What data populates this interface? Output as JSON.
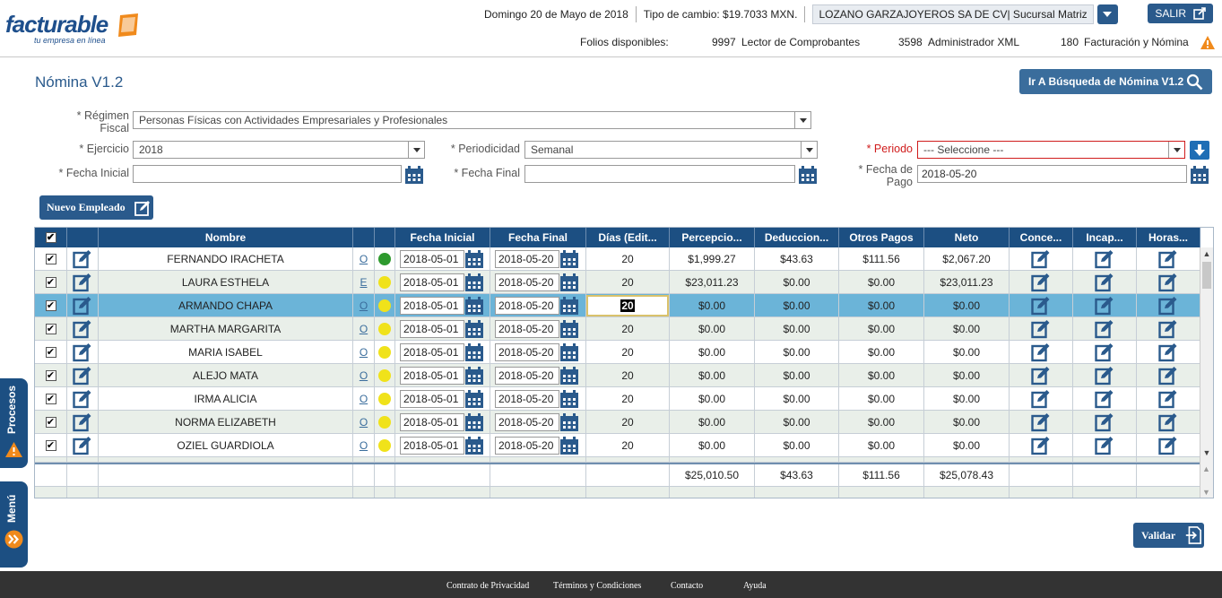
{
  "header": {
    "logo_brand": "facturable",
    "logo_tagline": "tu empresa en línea",
    "date": "Domingo 20 de Mayo de 2018",
    "exchange_rate": "Tipo de cambio: $19.7033 MXN.",
    "company": "LOZANO GARZAJOYEROS SA DE CV| Sucursal Matriz",
    "salir_label": "SALIR",
    "folios_label": "Folios disponibles:",
    "folios": [
      {
        "count": "9997",
        "label": "Lector de Comprobantes"
      },
      {
        "count": "3598",
        "label": "Administrador XML"
      },
      {
        "count": "180",
        "label": "Facturación y Nómina"
      }
    ]
  },
  "page": {
    "title": "Nómina V1.2",
    "search_button": "Ir A Búsqueda de  Nómina V1.2",
    "new_employee_button": "Nuevo Empleado",
    "validate_button": "Validar"
  },
  "form": {
    "regimen_label": "* Régimen Fiscal",
    "regimen_value": "Personas Físicas con Actividades Empresariales y Profesionales",
    "ejercicio_label": "* Ejercicio",
    "ejercicio_value": "2018",
    "periodicidad_label": "* Periodicidad",
    "periodicidad_value": "Semanal",
    "periodo_label": "* Periodo",
    "periodo_value": "--- Seleccione ---",
    "fecha_inicial_label": "* Fecha Inicial",
    "fecha_inicial_value": "",
    "fecha_final_label": "* Fecha Final",
    "fecha_final_value": "",
    "fecha_pago_label": "* Fecha de Pago",
    "fecha_pago_value": "2018-05-20"
  },
  "grid": {
    "headers": [
      "Nombre",
      "Fecha Inicial",
      "Fecha Final",
      "Días (Edit...",
      "Percepcio...",
      "Deduccion...",
      "Otros Pagos",
      "Neto",
      "Conce...",
      "Incap...",
      "Horas..."
    ],
    "rows": [
      {
        "name": "FERNANDO IRACHETA",
        "code": "O",
        "status_color": "#2e9a2e",
        "fi": "2018-05-01",
        "ff": "2018-05-20",
        "dias": "20",
        "perc": "$1,999.27",
        "ded": "$43.63",
        "otros": "$111.56",
        "neto": "$2,067.20"
      },
      {
        "name": "LAURA ESTHELA",
        "code": "E",
        "status_color": "#f0e21a",
        "fi": "2018-05-01",
        "ff": "2018-05-20",
        "dias": "20",
        "perc": "$23,011.23",
        "ded": "$0.00",
        "otros": "$0.00",
        "neto": "$23,011.23"
      },
      {
        "name": "ARMANDO CHAPA",
        "code": "O",
        "status_color": "#f0e21a",
        "fi": "2018-05-01",
        "ff": "2018-05-20",
        "dias": "20",
        "perc": "$0.00",
        "ded": "$0.00",
        "otros": "$0.00",
        "neto": "$0.00"
      },
      {
        "name": "MARTHA MARGARITA",
        "code": "O",
        "status_color": "#f0e21a",
        "fi": "2018-05-01",
        "ff": "2018-05-20",
        "dias": "20",
        "perc": "$0.00",
        "ded": "$0.00",
        "otros": "$0.00",
        "neto": "$0.00"
      },
      {
        "name": "MARIA ISABEL",
        "code": "O",
        "status_color": "#f0e21a",
        "fi": "2018-05-01",
        "ff": "2018-05-20",
        "dias": "20",
        "perc": "$0.00",
        "ded": "$0.00",
        "otros": "$0.00",
        "neto": "$0.00"
      },
      {
        "name": "ALEJO MATA",
        "code": "O",
        "status_color": "#f0e21a",
        "fi": "2018-05-01",
        "ff": "2018-05-20",
        "dias": "20",
        "perc": "$0.00",
        "ded": "$0.00",
        "otros": "$0.00",
        "neto": "$0.00"
      },
      {
        "name": "IRMA ALICIA",
        "code": "O",
        "status_color": "#f0e21a",
        "fi": "2018-05-01",
        "ff": "2018-05-20",
        "dias": "20",
        "perc": "$0.00",
        "ded": "$0.00",
        "otros": "$0.00",
        "neto": "$0.00"
      },
      {
        "name": "NORMA ELIZABETH",
        "code": "O",
        "status_color": "#f0e21a",
        "fi": "2018-05-01",
        "ff": "2018-05-20",
        "dias": "20",
        "perc": "$0.00",
        "ded": "$0.00",
        "otros": "$0.00",
        "neto": "$0.00"
      },
      {
        "name": "OZIEL GUARDIOLA",
        "code": "O",
        "status_color": "#f0e21a",
        "fi": "2018-05-01",
        "ff": "2018-05-20",
        "dias": "20",
        "perc": "$0.00",
        "ded": "$0.00",
        "otros": "$0.00",
        "neto": "$0.00"
      }
    ],
    "selected_index": 2,
    "totals": {
      "perc": "$25,010.50",
      "ded": "$43.63",
      "otros": "$111.56",
      "neto": "$25,078.43"
    }
  },
  "side_tabs": {
    "procesos": "Procesos",
    "menu": "Menú"
  },
  "footer": {
    "links": [
      "Contrato de Privacidad",
      "Términos y Condiciones",
      "Contacto",
      "Ayuda"
    ]
  },
  "colors": {
    "primary": "#1c4f82",
    "accent": "#f08a1c",
    "selected_row": "#6bb4d8",
    "error": "#d01c1c"
  }
}
